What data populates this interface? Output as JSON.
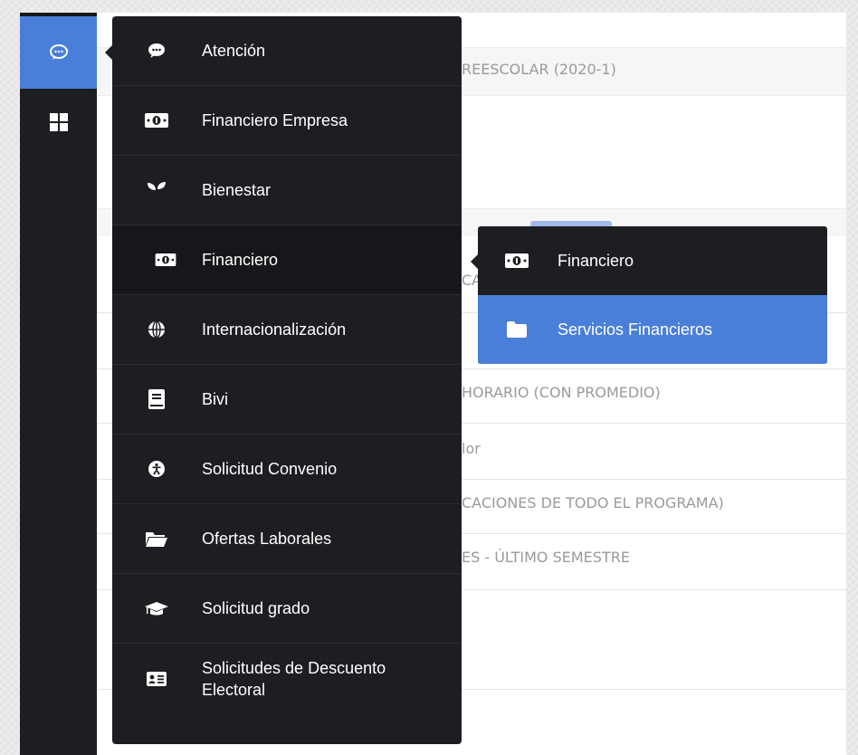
{
  "colors": {
    "accent": "#4a7fd9",
    "menu_bg": "#1d1e22",
    "page_bg": "#ffffff"
  },
  "rail": {
    "items": [
      {
        "icon": "chat-icon",
        "active": true
      },
      {
        "icon": "grid-icon",
        "active": false
      }
    ]
  },
  "background_page": {
    "rows": [
      "REESCOLAR (2020-1)",
      "CA",
      "HORARIO (CON PROMEDIO)",
      "lor",
      "CACIONES DE TODO EL PROGRAMA)",
      "ES - ÚLTIMO SEMESTRE"
    ]
  },
  "menu": {
    "items": [
      {
        "label": "Atención",
        "icon": "chat-icon"
      },
      {
        "label": "Financiero Empresa",
        "icon": "money-icon"
      },
      {
        "label": "Bienestar",
        "icon": "seedling-icon"
      },
      {
        "label": "Financiero",
        "icon": "money-icon"
      },
      {
        "label": "Internacionalización",
        "icon": "globe-icon"
      },
      {
        "label": "Bivi",
        "icon": "book-icon"
      },
      {
        "label": "Solicitud Convenio",
        "icon": "universal-access-icon"
      },
      {
        "label": "Ofertas Laborales",
        "icon": "folder-open-icon"
      },
      {
        "label": "Solicitud grado",
        "icon": "graduation-cap-icon"
      },
      {
        "label": "Solicitudes de Descuento Electoral",
        "icon": "id-card-icon"
      }
    ]
  },
  "submenu": {
    "header": {
      "label": "Financiero",
      "icon": "money-icon"
    },
    "items": [
      {
        "label": "Servicios Financieros",
        "icon": "folder-icon",
        "highlighted": true
      }
    ]
  }
}
